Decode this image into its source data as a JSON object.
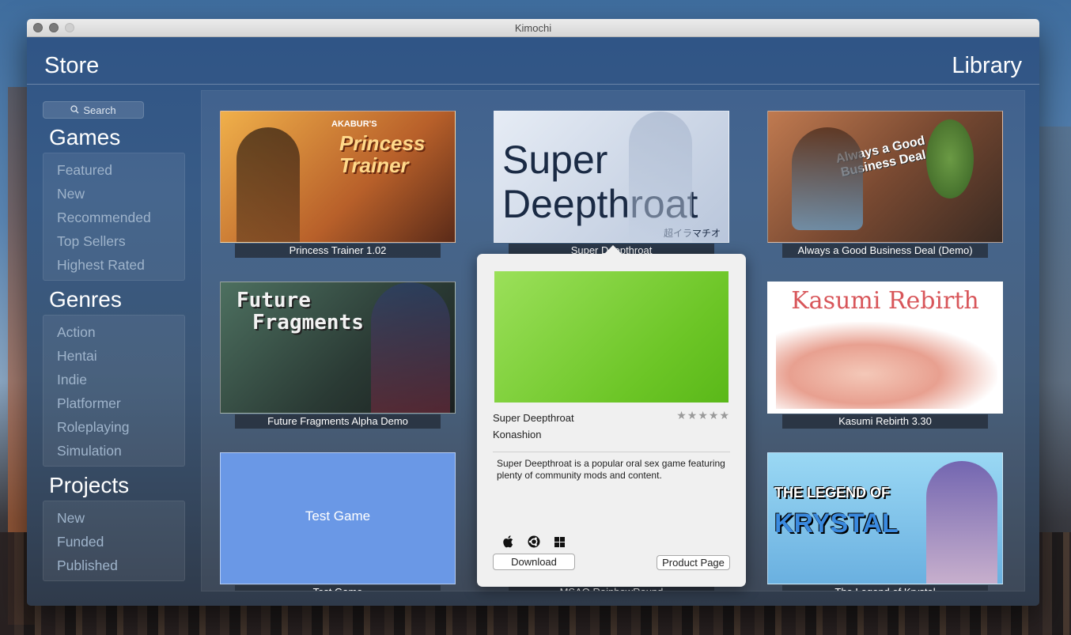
{
  "window": {
    "title": "Kimochi"
  },
  "header": {
    "store": "Store",
    "library": "Library"
  },
  "sidebar": {
    "search_placeholder": "Search",
    "sections": [
      {
        "title": "Games",
        "items": [
          "Featured",
          "New",
          "Recommended",
          "Top Sellers",
          "Highest Rated"
        ]
      },
      {
        "title": "Genres",
        "items": [
          "Action",
          "Hentai",
          "Indie",
          "Platformer",
          "Roleplaying",
          "Simulation"
        ]
      },
      {
        "title": "Projects",
        "items": [
          "New",
          "Funded",
          "Published"
        ]
      }
    ]
  },
  "games": [
    {
      "caption": "Princess Trainer 1.02",
      "art_title": "Princess Trainer",
      "art_brand": "AKABUR'S",
      "colors": [
        "#f2b24a",
        "#7a3d20"
      ]
    },
    {
      "caption": "Super Deepthroat",
      "art_title": "Super",
      "art_title2": "Deepthroat",
      "art_sub": "超イラマチオ",
      "colors": [
        "#dbe4f1",
        "#9fb0ca"
      ]
    },
    {
      "caption": "Always a Good Business Deal (Demo)",
      "art_title": "Always a Good Business Deal",
      "colors": [
        "#a06a4a",
        "#3a2a2a"
      ]
    },
    {
      "caption": "Future Fragments Alpha Demo",
      "art_title": "Future",
      "art_title2": "Fragments",
      "colors": [
        "#3d5a48",
        "#1c2522"
      ]
    },
    {
      "caption": "Kasumi Rebirth 3.30",
      "art_title": "Kasumi Rebirth",
      "colors": [
        "#ffffff",
        "#f2dada"
      ]
    },
    {
      "caption": "Test Game",
      "art_title": "Test Game",
      "colors": [
        "#6a98e6",
        "#6a98e6"
      ]
    },
    {
      "caption": "MSAQ RainbowRound",
      "art_title": "",
      "colors": [
        "#5a6a80",
        "#3a4a5a"
      ]
    },
    {
      "caption": "The Legend of Krystal",
      "art_title": "THE LEGEND OF",
      "art_title2": "KRYSTAL",
      "colors": [
        "#8ad0f0",
        "#4a7ab0"
      ]
    }
  ],
  "popover": {
    "title": "Super Deepthroat",
    "developer": "Konashion",
    "stars": "★★★★★",
    "description": "Super Deepthroat is a popular oral sex game featuring plenty of community mods and content.",
    "platforms": [
      "apple-icon",
      "ubuntu-icon",
      "windows-icon"
    ],
    "download_label": "Download",
    "product_page_label": "Product Page"
  }
}
